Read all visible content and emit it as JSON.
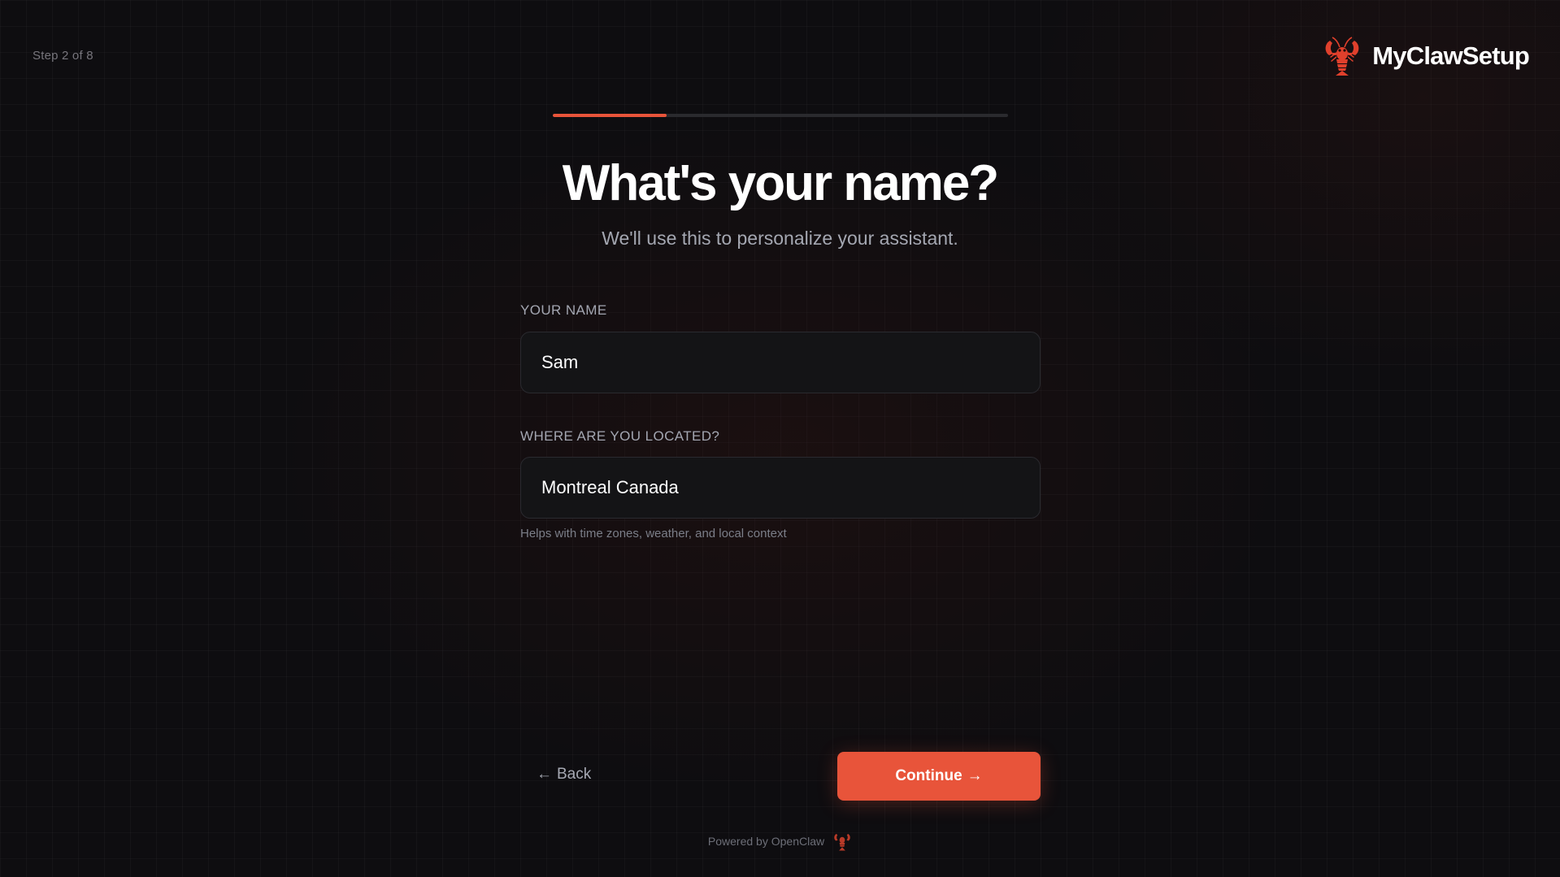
{
  "header": {
    "step_text": "Step 2 of 8",
    "brand_name": "MyClawSetup",
    "brand_icon": "lobster-icon"
  },
  "progress": {
    "current_step": 2,
    "total_steps": 8,
    "fraction": 0.25,
    "color": "#e8543a"
  },
  "main": {
    "title": "What's your name?",
    "subtitle": "We'll use this to personalize your assistant."
  },
  "form": {
    "name_label": "YOUR NAME",
    "name_value": "Sam",
    "location_label": "WHERE ARE YOU LOCATED?",
    "location_value": "Montreal Canada",
    "location_helper": "Helps with time zones, weather, and local context"
  },
  "nav": {
    "back_label": "Back",
    "back_icon": "←",
    "continue_label": "Continue",
    "continue_icon": "→"
  },
  "footer": {
    "powered_by": "Powered by OpenClaw",
    "footer_icon": "lobster-icon"
  },
  "colors": {
    "accent": "#e8543a",
    "background": "#0e0d10"
  }
}
